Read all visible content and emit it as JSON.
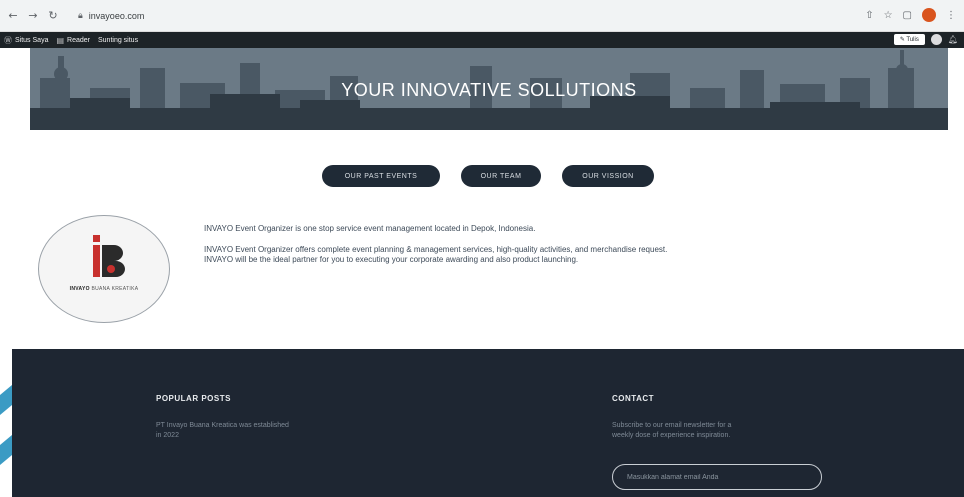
{
  "browser": {
    "url": "invayoeo.com",
    "back_icon": "arrow-left-icon",
    "forward_icon": "arrow-right-icon",
    "reload_icon": "reload-icon",
    "lock_icon": "lock-icon"
  },
  "admin_bar": {
    "items": [
      {
        "icon": "wordpress-icon",
        "label": "Situs Saya"
      },
      {
        "icon": "reader-icon",
        "label": "Reader"
      },
      {
        "icon": "",
        "label": "Sunting situs"
      }
    ],
    "edit_label": "✎ Tulis"
  },
  "hero": {
    "title": "YOUR INNOVATIVE SOLLUTIONS"
  },
  "nav_buttons": [
    {
      "label": "OUR PAST EVENTS"
    },
    {
      "label": "OUR TEAM"
    },
    {
      "label": "OUR VISSION"
    }
  ],
  "logo": {
    "brand_bold": "INVAYO",
    "brand_rest": " BUANA KREATIKA"
  },
  "about": {
    "paragraph1": "INVAYO Event Organizer is one stop service event management located in Depok, Indonesia.",
    "paragraph2_line1": "INVAYO Event Organizer offers complete event planning & management services, high-quality activities, and merchandise request.",
    "paragraph2_line2": "INVAYO will be the ideal partner for you to executing your corporate awarding and also product launching."
  },
  "footer": {
    "popular_posts": {
      "heading": "POPULAR POSTS",
      "text_line1": "PT Invayo Buana Kreatica was established",
      "text_line2": "in 2022"
    },
    "contact": {
      "heading": "CONTACT",
      "text_line1": "Subscribe to our email newsletter for a",
      "text_line2": "weekly dose of experience inspiration.",
      "email_placeholder": "Masukkan alamat email Anda"
    }
  },
  "colors": {
    "accent_stripe": "#3b9bc4",
    "hero_bg": "#5b6b78",
    "button_bg": "#1f2a36",
    "footer_bg": "#1e2632"
  }
}
